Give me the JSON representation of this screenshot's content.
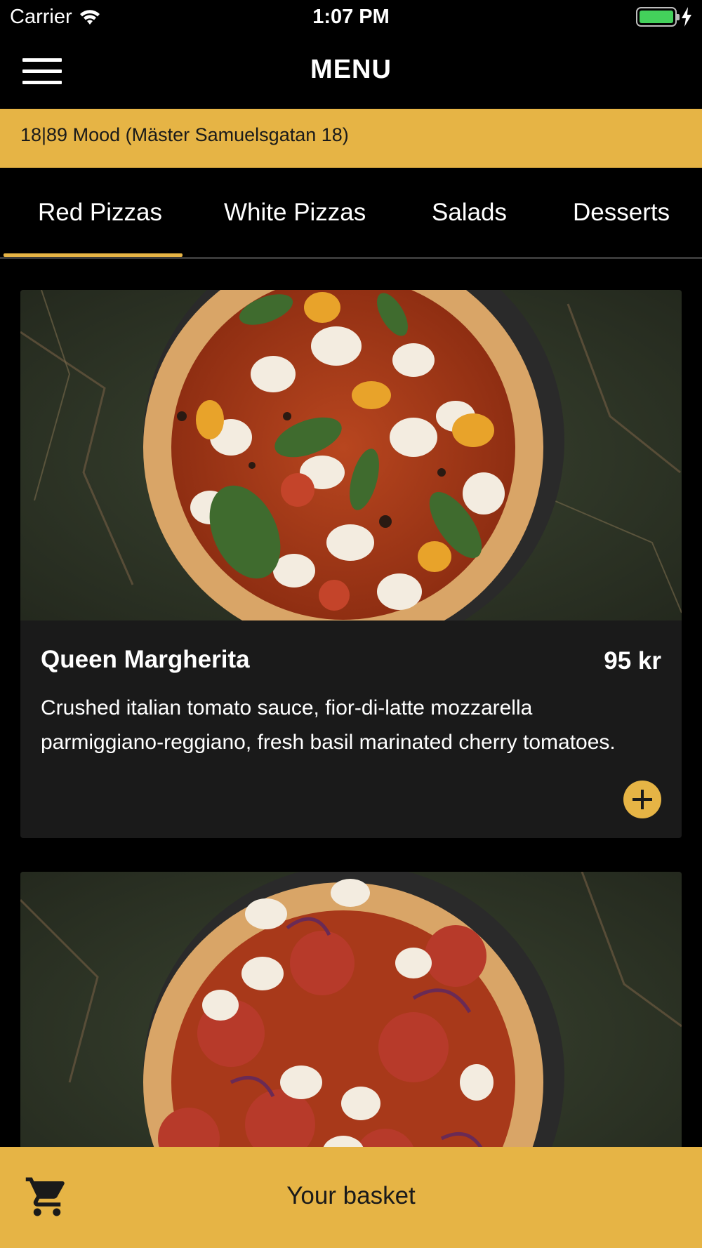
{
  "status_bar": {
    "carrier": "Carrier",
    "time": "1:07 PM",
    "battery_level": 1.0,
    "charging": true
  },
  "nav": {
    "title": "MENU",
    "menu_icon": "hamburger-menu-icon"
  },
  "location": {
    "label": "18|89 Mood (Mäster Samuelsgatan 18)"
  },
  "tabs": [
    {
      "label": "Red Pizzas",
      "selected": true
    },
    {
      "label": "White Pizzas",
      "selected": false
    },
    {
      "label": "Salads",
      "selected": false
    },
    {
      "label": "Desserts",
      "selected": false
    }
  ],
  "items": [
    {
      "name": "Queen Margherita",
      "price": "95 kr",
      "description": "Crushed italian tomato sauce, fior-di-latte mozzarella parmiggiano-reggiano, fresh basil marinated cherry tomatoes."
    }
  ],
  "basket": {
    "label": "Your basket",
    "icon": "shopping-cart-icon"
  },
  "colors": {
    "accent": "#e6b445",
    "background": "#000000",
    "card": "#1a1a1a"
  }
}
